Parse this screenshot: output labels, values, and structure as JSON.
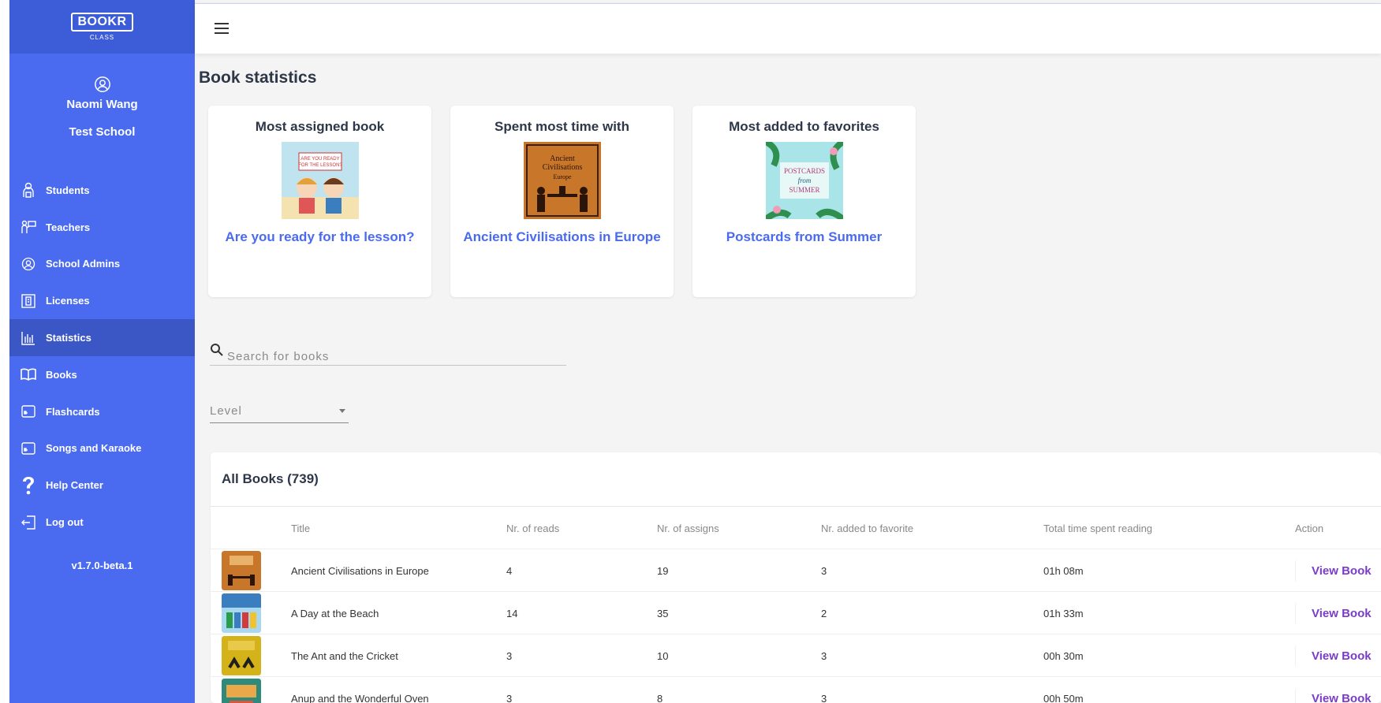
{
  "app": {
    "logo_text": "BOOKR",
    "logo_sub": "CLASS",
    "version": "v1.7.0-beta.1"
  },
  "user": {
    "name": "Naomi Wang",
    "school": "Test School"
  },
  "sidebar": {
    "items": [
      {
        "label": "Students",
        "icon": "student-icon",
        "active": false
      },
      {
        "label": "Teachers",
        "icon": "teacher-icon",
        "active": false
      },
      {
        "label": "School Admins",
        "icon": "user-circle-icon",
        "active": false
      },
      {
        "label": "Licenses",
        "icon": "license-icon",
        "active": false
      },
      {
        "label": "Statistics",
        "icon": "bar-chart-icon",
        "active": true
      },
      {
        "label": "Books",
        "icon": "book-icon",
        "active": false
      },
      {
        "label": "Flashcards",
        "icon": "flashcard-icon",
        "active": false
      },
      {
        "label": "Songs and Karaoke",
        "icon": "karaoke-icon",
        "active": false
      },
      {
        "label": "Help Center",
        "icon": "question-icon",
        "active": false
      },
      {
        "label": "Log out",
        "icon": "logout-icon",
        "active": false
      }
    ]
  },
  "page": {
    "title": "Book statistics"
  },
  "highlights": [
    {
      "heading": "Most assigned book",
      "book": "Are you ready for the lesson?",
      "cover_text": "ARE YOU READY FOR THE LESSON?"
    },
    {
      "heading": "Spent most time with",
      "book": "Ancient Civilisations in Europe",
      "cover_text": "Ancient Civilisations Europe"
    },
    {
      "heading": "Most added to favorites",
      "book": "Postcards from Summer",
      "cover_text": "POSTCARDS from SUMMER"
    }
  ],
  "search": {
    "placeholder": "Search for books"
  },
  "filters": {
    "level_label": "Level"
  },
  "table": {
    "title": "All Books (739)",
    "columns": [
      "Title",
      "Nr. of reads",
      "Nr. of assigns",
      "Nr. added to favorite",
      "Total time spent reading",
      "Action"
    ],
    "rows": [
      {
        "title": "Ancient Civilisations in Europe",
        "reads": "4",
        "assigns": "19",
        "favorites": "3",
        "time": "01h 08m",
        "action": "View Book",
        "cover_color": "#b5651d"
      },
      {
        "title": "A Day at the Beach",
        "reads": "14",
        "assigns": "35",
        "favorites": "2",
        "time": "01h 33m",
        "action": "View Book",
        "cover_color": "#3a7ebf"
      },
      {
        "title": "The Ant and the Cricket",
        "reads": "3",
        "assigns": "10",
        "favorites": "3",
        "time": "00h 30m",
        "action": "View Book",
        "cover_color": "#d4b21a"
      },
      {
        "title": "Anup and the Wonderful Oven",
        "reads": "3",
        "assigns": "8",
        "favorites": "3",
        "time": "00h 50m",
        "action": "View Book",
        "cover_color": "#2e8a7a"
      }
    ]
  }
}
